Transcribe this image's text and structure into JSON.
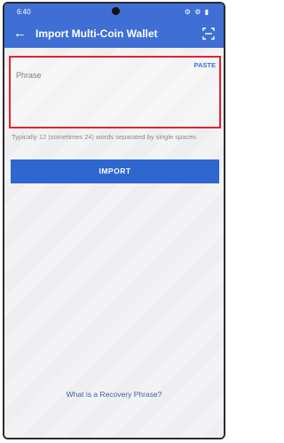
{
  "status_bar": {
    "time": "6:40",
    "icons_text": "⚙ ⚙ ▮"
  },
  "header": {
    "title": "Import Multi-Coin Wallet",
    "back_icon": "back-arrow-icon",
    "scan_icon": "qr-scan-icon"
  },
  "phrase_field": {
    "placeholder": "Phrase",
    "paste_label": "PASTE",
    "hint": "Typically 12 (sometimes 24) words separated by single spaces"
  },
  "actions": {
    "import_label": "IMPORT",
    "recovery_link": "What is a Recovery Phrase?"
  },
  "colors": {
    "appbar": "#3f6fd4",
    "button": "#2f66cf",
    "highlight": "#e1242a"
  }
}
